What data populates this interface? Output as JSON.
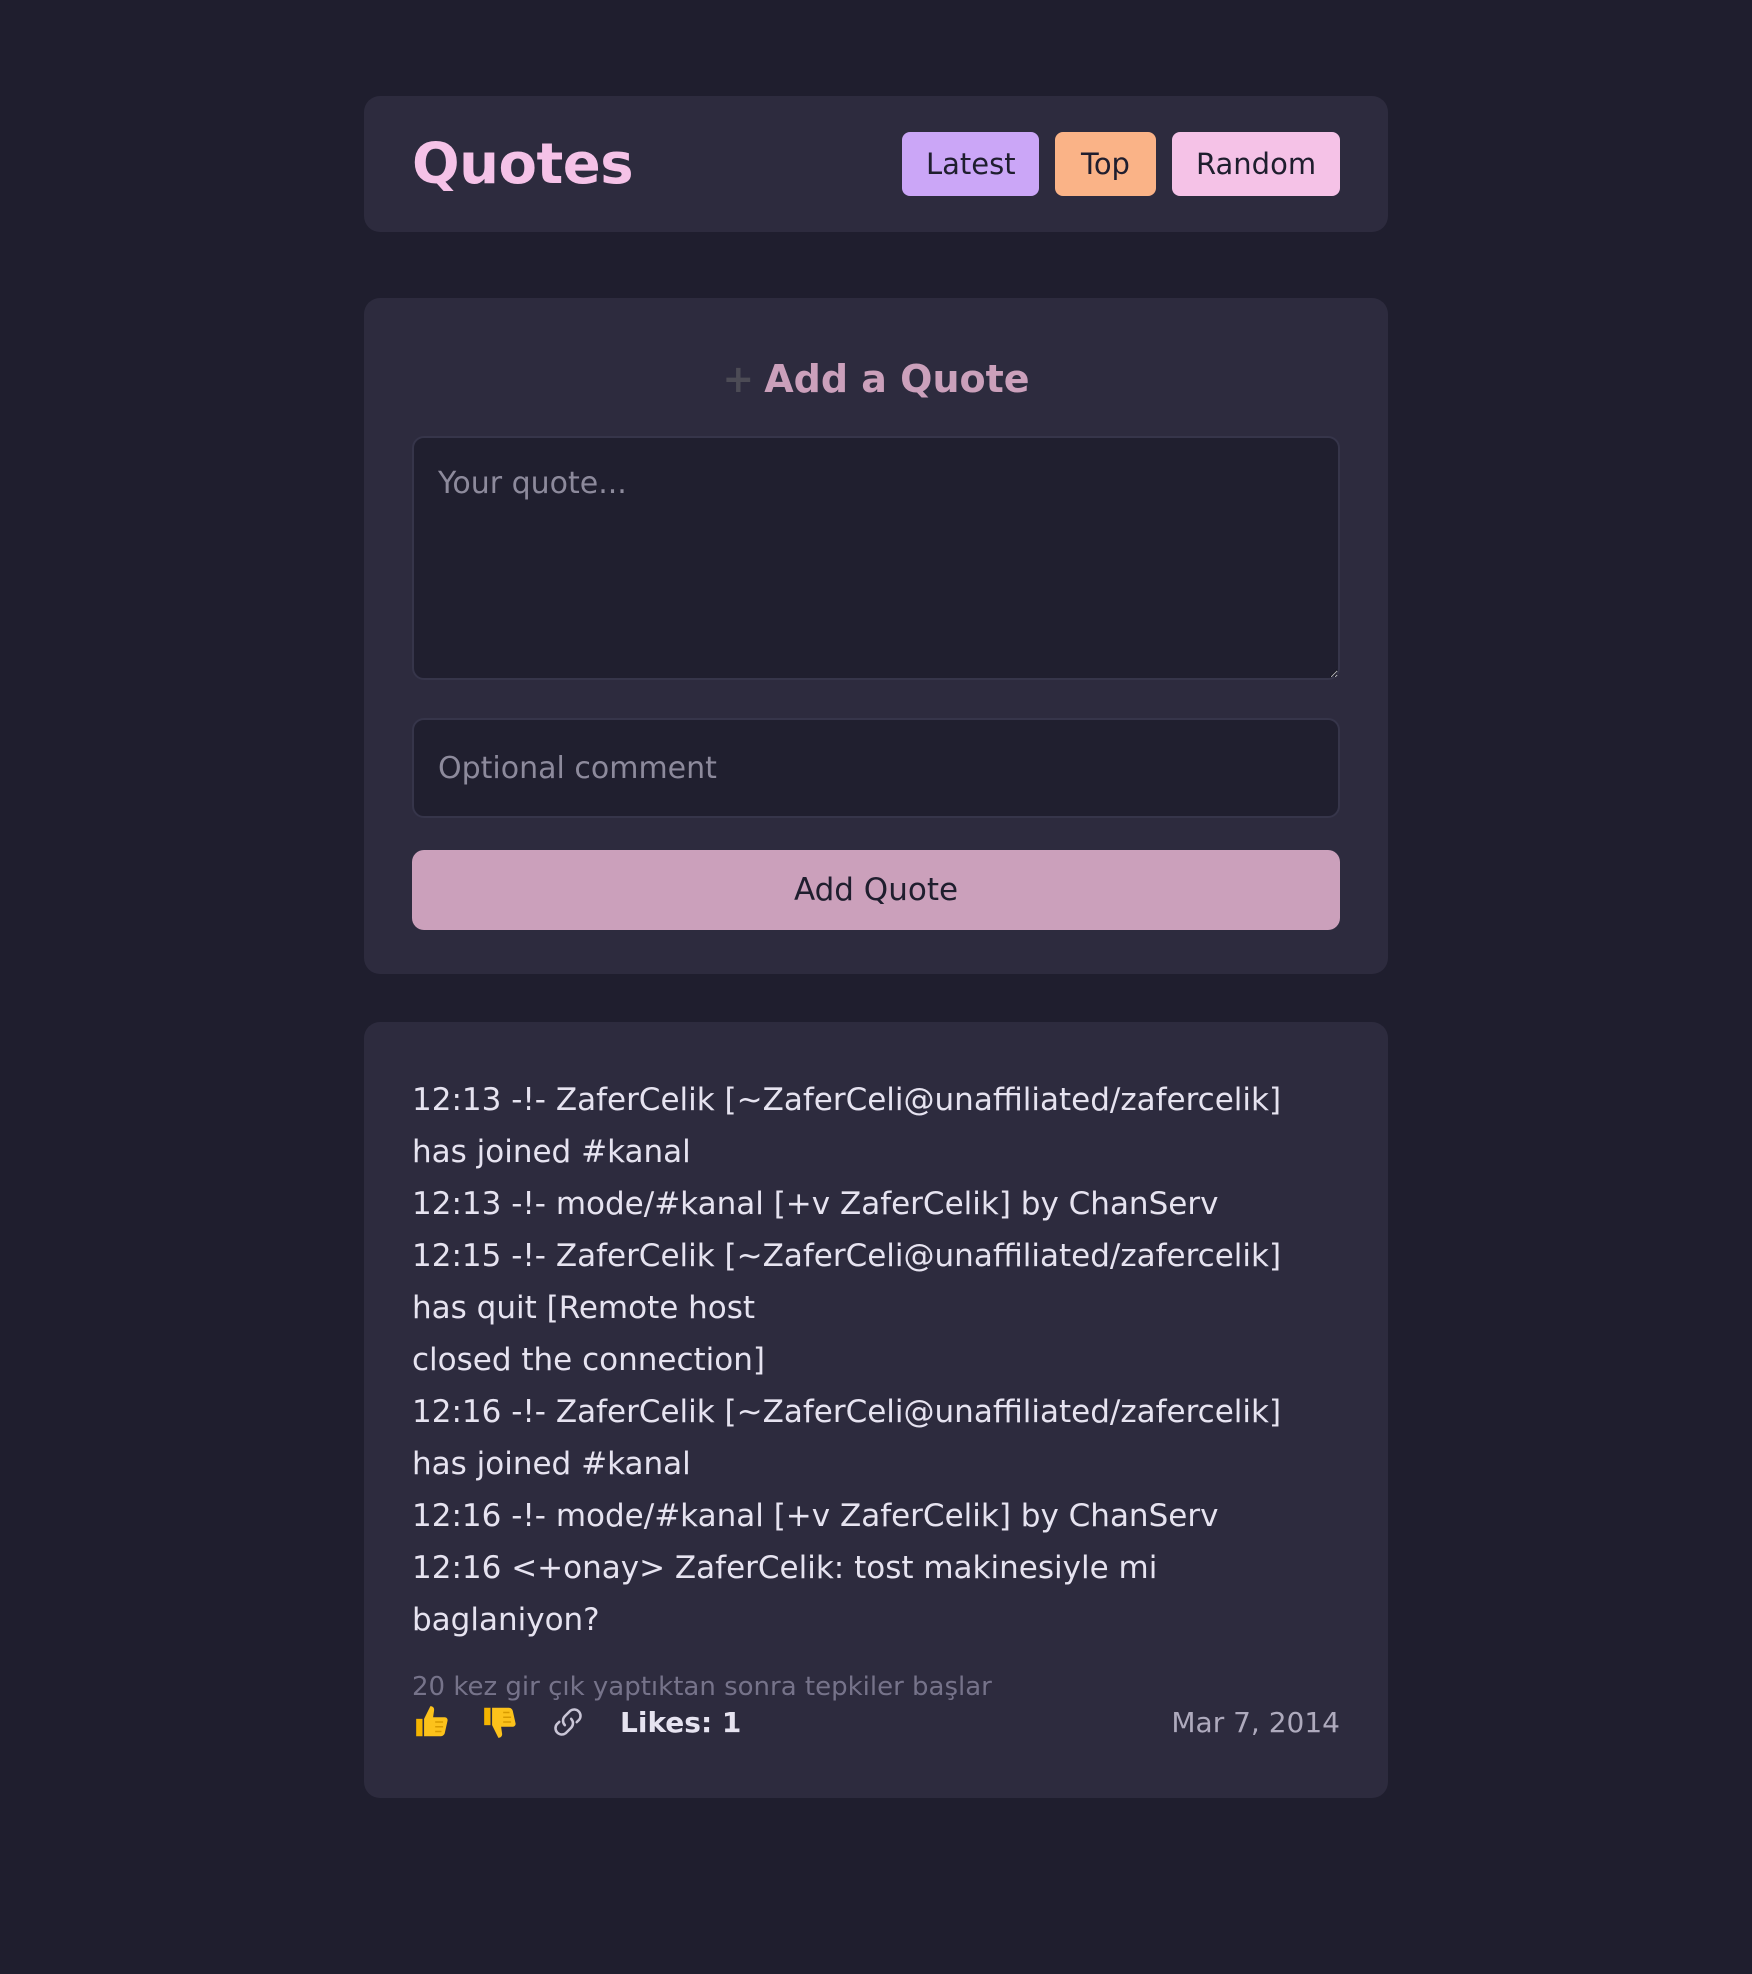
{
  "header": {
    "title": "Quotes",
    "nav": {
      "latest": "Latest",
      "top": "Top",
      "random": "Random"
    }
  },
  "add_form": {
    "plus_glyph": "+",
    "title": "Add a Quote",
    "quote_placeholder": "Your quote...",
    "comment_placeholder": "Optional comment",
    "submit_label": "Add Quote"
  },
  "quote": {
    "lines": [
      "12:13 -!- ZaferCelik [~ZaferCeli@unaffiliated/zafercelik] has joined #kanal",
      "12:13 -!- mode/#kanal [+v ZaferCelik] by ChanServ",
      "12:15 -!- ZaferCelik [~ZaferCeli@unaffiliated/zafercelik] has quit [Remote host",
      "closed the connection]",
      "12:16 -!- ZaferCelik [~ZaferCeli@unaffiliated/zafercelik] has joined #kanal",
      "12:16 -!- mode/#kanal [+v ZaferCelik] by ChanServ",
      "12:16 <+onay> ZaferCelik: tost makinesiyle mi baglaniyon?"
    ],
    "comment": "20 kez gir çık yaptıktan sonra tepkiler başlar",
    "likes_label": "Likes: 1",
    "date": "Mar 7, 2014",
    "icons": {
      "like": "thumbs-up-icon",
      "dislike": "thumbs-down-icon",
      "permalink": "link-icon"
    }
  },
  "colors": {
    "background": "#1f1e2e",
    "card": "#2d2b3e",
    "title": "#f5c2e7",
    "latest": "#cba6f7",
    "top": "#fab387",
    "random": "#f5c2e7",
    "submit": "#cba0bb"
  }
}
